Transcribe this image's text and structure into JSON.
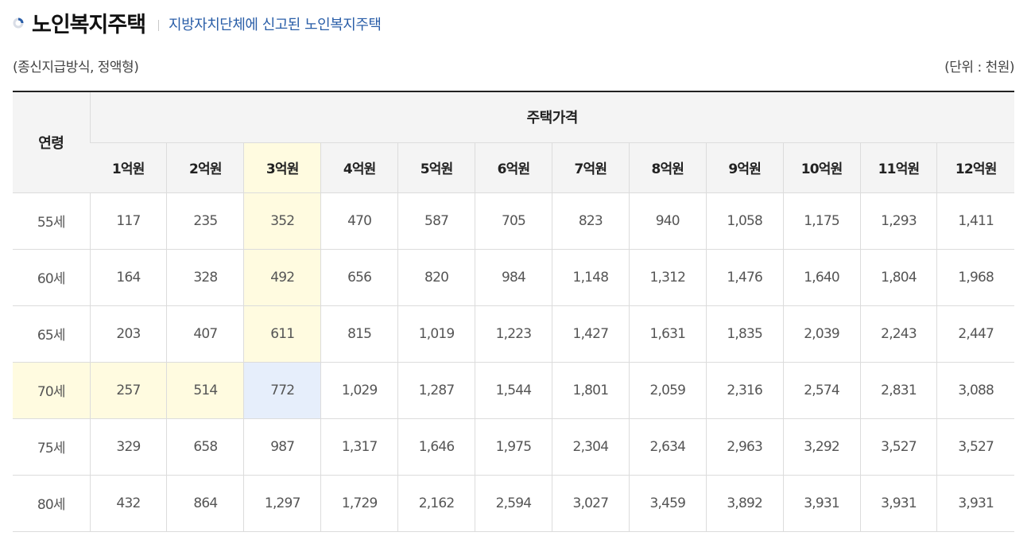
{
  "header": {
    "title": "노인복지주택",
    "subtitle": "지방자치단체에 신고된 노인복지주택"
  },
  "meta": {
    "left": "(종신지급방식, 정액형)",
    "right": "(단위 : 천원)"
  },
  "colors": {
    "highlight_yellow": "#fffbe0",
    "highlight_blue": "#e6eefb",
    "subtitle": "#2a5ea8"
  },
  "table": {
    "age_header": "연령",
    "group_header": "주택가격",
    "price_headers": [
      "1억원",
      "2억원",
      "3억원",
      "4억원",
      "5억원",
      "6억원",
      "7억원",
      "8억원",
      "9억원",
      "10억원",
      "11억원",
      "12억원"
    ],
    "rows": [
      {
        "age": "55세",
        "values": [
          "117",
          "235",
          "352",
          "470",
          "587",
          "705",
          "823",
          "940",
          "1,058",
          "1,175",
          "1,293",
          "1,411"
        ]
      },
      {
        "age": "60세",
        "values": [
          "164",
          "328",
          "492",
          "656",
          "820",
          "984",
          "1,148",
          "1,312",
          "1,476",
          "1,640",
          "1,804",
          "1,968"
        ]
      },
      {
        "age": "65세",
        "values": [
          "203",
          "407",
          "611",
          "815",
          "1,019",
          "1,223",
          "1,427",
          "1,631",
          "1,835",
          "2,039",
          "2,243",
          "2,447"
        ]
      },
      {
        "age": "70세",
        "values": [
          "257",
          "514",
          "772",
          "1,029",
          "1,287",
          "1,544",
          "1,801",
          "2,059",
          "2,316",
          "2,574",
          "2,831",
          "3,088"
        ]
      },
      {
        "age": "75세",
        "values": [
          "329",
          "658",
          "987",
          "1,317",
          "1,646",
          "1,975",
          "2,304",
          "2,634",
          "2,963",
          "3,292",
          "3,527",
          "3,527"
        ]
      },
      {
        "age": "80세",
        "values": [
          "432",
          "864",
          "1,297",
          "1,729",
          "2,162",
          "2,594",
          "3,027",
          "3,459",
          "3,892",
          "3,931",
          "3,931",
          "3,931"
        ]
      }
    ]
  }
}
